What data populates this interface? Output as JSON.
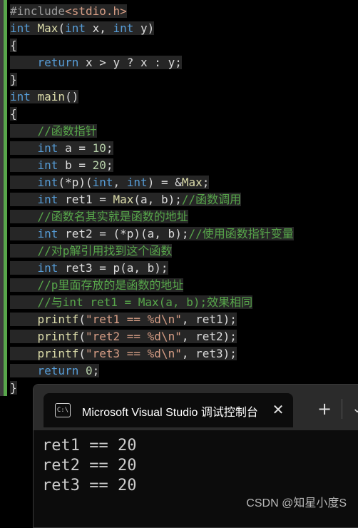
{
  "editor": {
    "lines": [
      {
        "tokens": [
          {
            "t": "#include",
            "c": "pp"
          },
          {
            "t": "<stdio.h>",
            "c": "st"
          }
        ]
      },
      {
        "tokens": [
          {
            "t": "int ",
            "c": "kw"
          },
          {
            "t": "Max",
            "c": "fn"
          },
          {
            "t": "(",
            "c": "bl"
          },
          {
            "t": "int ",
            "c": "kw"
          },
          {
            "t": "x, ",
            "c": "bl"
          },
          {
            "t": "int ",
            "c": "kw"
          },
          {
            "t": "y)",
            "c": "bl"
          }
        ]
      },
      {
        "tokens": [
          {
            "t": "{",
            "c": "bl"
          }
        ]
      },
      {
        "tokens": [
          {
            "t": "    ",
            "c": "bl"
          },
          {
            "t": "return ",
            "c": "kw"
          },
          {
            "t": "x > y ? x : y;",
            "c": "bl"
          }
        ]
      },
      {
        "tokens": [
          {
            "t": "}",
            "c": "bl"
          }
        ]
      },
      {
        "tokens": [
          {
            "t": "int ",
            "c": "kw"
          },
          {
            "t": "main",
            "c": "fn"
          },
          {
            "t": "()",
            "c": "bl"
          }
        ]
      },
      {
        "tokens": [
          {
            "t": "{",
            "c": "bl"
          }
        ]
      },
      {
        "tokens": [
          {
            "t": "    ",
            "c": "bl"
          },
          {
            "t": "//函数指针",
            "c": "cm"
          }
        ]
      },
      {
        "tokens": [
          {
            "t": "    ",
            "c": "bl"
          },
          {
            "t": "int ",
            "c": "kw"
          },
          {
            "t": "a = ",
            "c": "bl"
          },
          {
            "t": "10",
            "c": "nm"
          },
          {
            "t": ";",
            "c": "bl"
          }
        ]
      },
      {
        "tokens": [
          {
            "t": "    ",
            "c": "bl"
          },
          {
            "t": "int ",
            "c": "kw"
          },
          {
            "t": "b = ",
            "c": "bl"
          },
          {
            "t": "20",
            "c": "nm"
          },
          {
            "t": ";",
            "c": "bl"
          }
        ]
      },
      {
        "tokens": [
          {
            "t": "    ",
            "c": "bl"
          },
          {
            "t": "int",
            "c": "kw"
          },
          {
            "t": "(*p)(",
            "c": "bl"
          },
          {
            "t": "int",
            "c": "kw"
          },
          {
            "t": ", ",
            "c": "bl"
          },
          {
            "t": "int",
            "c": "kw"
          },
          {
            "t": ") = &",
            "c": "bl"
          },
          {
            "t": "Max",
            "c": "fn"
          },
          {
            "t": ";",
            "c": "bl"
          }
        ]
      },
      {
        "tokens": [
          {
            "t": "    ",
            "c": "bl"
          },
          {
            "t": "int ",
            "c": "kw"
          },
          {
            "t": "ret1 = ",
            "c": "bl"
          },
          {
            "t": "Max",
            "c": "fn"
          },
          {
            "t": "(a, b);",
            "c": "bl"
          },
          {
            "t": "//函数调用",
            "c": "cm"
          }
        ]
      },
      {
        "tokens": [
          {
            "t": "    ",
            "c": "bl"
          },
          {
            "t": "//函数名其实就是函数的地址",
            "c": "cm"
          }
        ]
      },
      {
        "tokens": [
          {
            "t": "    ",
            "c": "bl"
          },
          {
            "t": "int ",
            "c": "kw"
          },
          {
            "t": "ret2 = (*p)(a, b);",
            "c": "bl"
          },
          {
            "t": "//使用函数指针变量",
            "c": "cm"
          }
        ]
      },
      {
        "tokens": [
          {
            "t": "    ",
            "c": "bl"
          },
          {
            "t": "//对p解引用找到这个函数",
            "c": "cm"
          }
        ]
      },
      {
        "tokens": [
          {
            "t": "    ",
            "c": "bl"
          },
          {
            "t": "int ",
            "c": "kw"
          },
          {
            "t": "ret3 = p(a, b);",
            "c": "bl"
          }
        ]
      },
      {
        "tokens": [
          {
            "t": "    ",
            "c": "bl"
          },
          {
            "t": "//p里面存放的是函数的地址",
            "c": "cm"
          }
        ]
      },
      {
        "tokens": [
          {
            "t": "    ",
            "c": "bl"
          },
          {
            "t": "//与int ret1 = Max(a, b);效果相同",
            "c": "cm"
          }
        ]
      },
      {
        "tokens": [
          {
            "t": "    ",
            "c": "bl"
          },
          {
            "t": "printf",
            "c": "fn"
          },
          {
            "t": "(",
            "c": "bl"
          },
          {
            "t": "\"ret1 == %d\\n\"",
            "c": "st"
          },
          {
            "t": ", ret1);",
            "c": "bl"
          }
        ]
      },
      {
        "tokens": [
          {
            "t": "    ",
            "c": "bl"
          },
          {
            "t": "printf",
            "c": "fn"
          },
          {
            "t": "(",
            "c": "bl"
          },
          {
            "t": "\"ret2 == %d\\n\"",
            "c": "st"
          },
          {
            "t": ", ret2);",
            "c": "bl"
          }
        ]
      },
      {
        "tokens": [
          {
            "t": "    ",
            "c": "bl"
          },
          {
            "t": "printf",
            "c": "fn"
          },
          {
            "t": "(",
            "c": "bl"
          },
          {
            "t": "\"ret3 == %d\\n\"",
            "c": "st"
          },
          {
            "t": ", ret3);",
            "c": "bl"
          }
        ]
      },
      {
        "tokens": [
          {
            "t": "    ",
            "c": "bl"
          },
          {
            "t": "return ",
            "c": "kw"
          },
          {
            "t": "0",
            "c": "nm"
          },
          {
            "t": ";",
            "c": "bl"
          }
        ]
      },
      {
        "tokens": [
          {
            "t": "}",
            "c": "bl"
          }
        ]
      }
    ]
  },
  "terminal": {
    "tab_title": "Microsoft Visual Studio 调试控制台",
    "icon": "terminal-icon",
    "close_glyph": "✕",
    "new_tab_glyph": "+",
    "dropdown_glyph": "⌄",
    "output": [
      "ret1 == 20",
      "ret2 == 20",
      "ret3 == 20"
    ]
  },
  "watermark": "CSDN @知星小度S",
  "colors": {
    "keyword": "#569cd6",
    "function": "#dcdcaa",
    "comment": "#57a64a",
    "string": "#d69d85",
    "number": "#b5cea8",
    "text": "#dcdcdc",
    "editor_bg": "#000000",
    "terminal_bg": "#0c0c0c",
    "titlebar_bg": "#2b2b2b"
  }
}
